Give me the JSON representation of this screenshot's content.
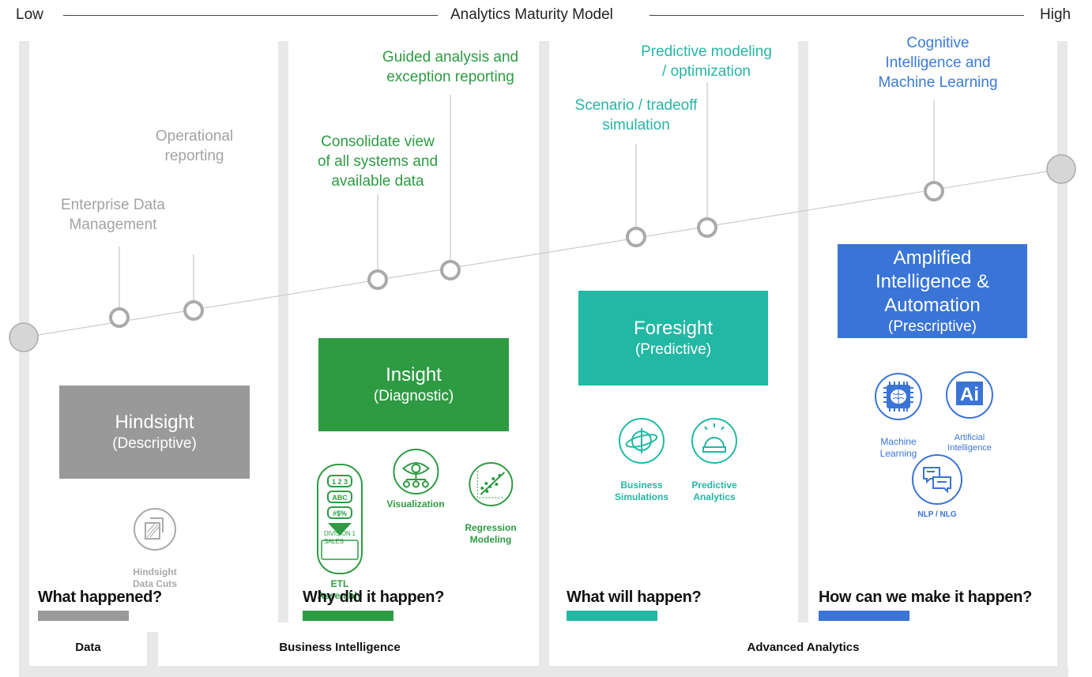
{
  "header": {
    "low": "Low",
    "title": "Analytics Maturity Model",
    "high": "High"
  },
  "colors": {
    "descriptive": "#999999",
    "diagnostic": "#2e9b43",
    "predictive": "#22b8a4",
    "prescriptive": "#3a74d6",
    "frame": "#e8e8e8"
  },
  "milestones": [
    {
      "label": "Enterprise Data\nManagement",
      "color": "#a3a3a3"
    },
    {
      "label": "Operational\nreporting",
      "color": "#a3a3a3"
    },
    {
      "label": "Consolidate view\nof all systems and\navailable data",
      "color": "#2e9b43"
    },
    {
      "label": "Guided analysis and\nexception reporting",
      "color": "#2e9b43"
    },
    {
      "label": "Scenario / tradeoff\nsimulation",
      "color": "#27b5a5"
    },
    {
      "label": "Predictive modeling\n/ optimization",
      "color": "#27b5a5"
    },
    {
      "label": "Cognitive\nIntelligence and\nMachine Learning",
      "color": "#3a7bd5"
    }
  ],
  "stages": [
    {
      "title": "Hindsight",
      "subtitle": "(Descriptive)",
      "question": "What happened?",
      "icons": [
        {
          "label": "Hindsight\nData Cuts",
          "icon": "data-cuts-icon"
        }
      ]
    },
    {
      "title": "Insight",
      "subtitle": "(Diagnostic)",
      "question": "Why did it happen?",
      "icons": [
        {
          "label": "ETL\nAssembly",
          "icon": "etl-icon",
          "inner": [
            "1 2 3",
            "ABC",
            "#$%",
            "DIVISION 1\nSALES"
          ]
        },
        {
          "label": "Visualization",
          "icon": "eye-icon"
        },
        {
          "label": "Regression\nModeling",
          "icon": "scatter-plot-icon"
        }
      ]
    },
    {
      "title": "Foresight",
      "subtitle": "(Predictive)",
      "question": "What will happen?",
      "icons": [
        {
          "label": "Business\nSimulations",
          "icon": "globe-orbit-icon"
        },
        {
          "label": "Predictive\nAnalytics",
          "icon": "crystal-ball-icon"
        }
      ]
    },
    {
      "title": "Amplified\nIntelligence &\nAutomation",
      "subtitle": "(Prescriptive)",
      "question": "How can we make it happen?",
      "icons": [
        {
          "label": "Machine\nLearning",
          "icon": "brain-chip-icon"
        },
        {
          "label": "Artificial\nIntelligence",
          "icon": "ai-icon",
          "inner": "Ai"
        },
        {
          "label": "NLP / NLG",
          "icon": "chat-bubbles-icon"
        }
      ]
    }
  ],
  "footer": [
    "Data",
    "Business Intelligence",
    "Advanced Analytics"
  ]
}
